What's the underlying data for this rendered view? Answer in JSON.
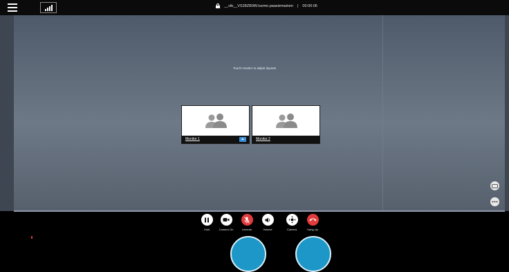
{
  "header": {
    "session_title": "__vib__VS28ZB0W.luomo.paasiemainen",
    "separator": "|",
    "elapsed_time": "00:00:06"
  },
  "stage": {
    "hint": "Touch monitor to adjust layouts"
  },
  "monitors": [
    {
      "label": "Monitor 1",
      "active_icon": "upload-icon"
    },
    {
      "label": "Monitor 2"
    }
  ],
  "side_icons": [
    "closed-captions-icon",
    "more-icon"
  ],
  "controls": [
    {
      "label": "Hold",
      "icon": "pause-icon"
    },
    {
      "label": "Camera On",
      "icon": "camera-icon"
    },
    {
      "label": "Unmute",
      "icon": "mic-muted-icon",
      "color": "#e23b3b"
    },
    {
      "label": "Volume",
      "icon": "volume-icon"
    },
    {
      "label": "Camera",
      "icon": "camera-control-icon"
    },
    {
      "label": "Hang Up",
      "icon": "hang-up-icon",
      "color": "#e23b3b"
    }
  ],
  "colors": {
    "accent": "#3b8fd8",
    "danger": "#e23b3b",
    "bubble": "#1d97c7"
  }
}
